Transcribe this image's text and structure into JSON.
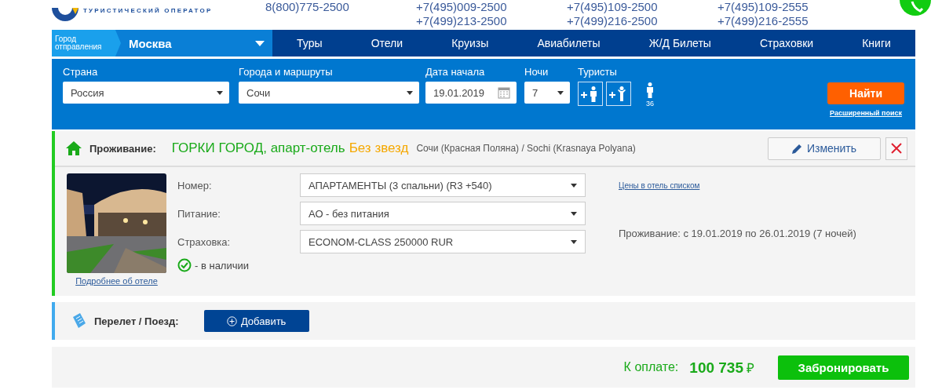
{
  "header": {
    "tagline": "ТУРИСТИЧЕСКИЙ ОПЕРАТОР",
    "phones": [
      [
        "8(800)775-2500"
      ],
      [
        "+7(495)009-2500",
        "+7(499)213-2500"
      ],
      [
        "+7(495)109-2500",
        "+7(499)216-2500"
      ],
      [
        "+7(495)109-2555",
        "+7(499)216-2555"
      ]
    ]
  },
  "departure": {
    "label": "Город отправления",
    "city": "Москва"
  },
  "nav": [
    {
      "label": "Туры",
      "selected": false
    },
    {
      "label": "Отели",
      "selected": false
    },
    {
      "label": "Круизы",
      "selected": false
    },
    {
      "label": "Авиабилеты",
      "selected": false
    },
    {
      "label": "Ж/Д Билеты",
      "selected": false
    },
    {
      "label": "Страховки",
      "selected": false
    },
    {
      "label": "Книги",
      "selected": false
    }
  ],
  "search": {
    "country": {
      "label": "Страна",
      "value": "Россия"
    },
    "city": {
      "label": "Города и маршруты",
      "value": "Сочи"
    },
    "date": {
      "label": "Дата начала",
      "value": "19.01.2019"
    },
    "nights": {
      "label": "Ночи",
      "value": "7"
    },
    "tourists": {
      "label": "Туристы",
      "adult_age": "36"
    },
    "find_button": "Найти",
    "advanced_link": "Расширенный поиск"
  },
  "hotel": {
    "section_label": "Проживание:",
    "name": "ГОРКИ ГОРОД, апарт-отель",
    "stars": "Без звезд",
    "location": "Сочи (Красная Поляна) / Sochi (Krasnaya Polyana)",
    "edit_button": "Изменить",
    "details_link": "Подробнее об отеле",
    "availability": "- в наличии",
    "fields": [
      {
        "label": "Номер:",
        "value": "АПАРТАМЕНТЫ (3 спальни) (R3 +540)"
      },
      {
        "label": "Питание:",
        "value": "АО - без питания"
      },
      {
        "label": "Страховка:",
        "value": "ECONOM-CLASS 250000 RUR"
      }
    ],
    "prices_link": "Цены в отель списком",
    "stay_info": "Проживание: с 19.01.2019 по 26.01.2019 (7 ночей)"
  },
  "transport": {
    "label": "Перелет / Поезд:",
    "add_button": "Добавить"
  },
  "total": {
    "label": "К оплате:",
    "amount": "100 735",
    "currency": "₽",
    "book_button": "Забронировать"
  }
}
